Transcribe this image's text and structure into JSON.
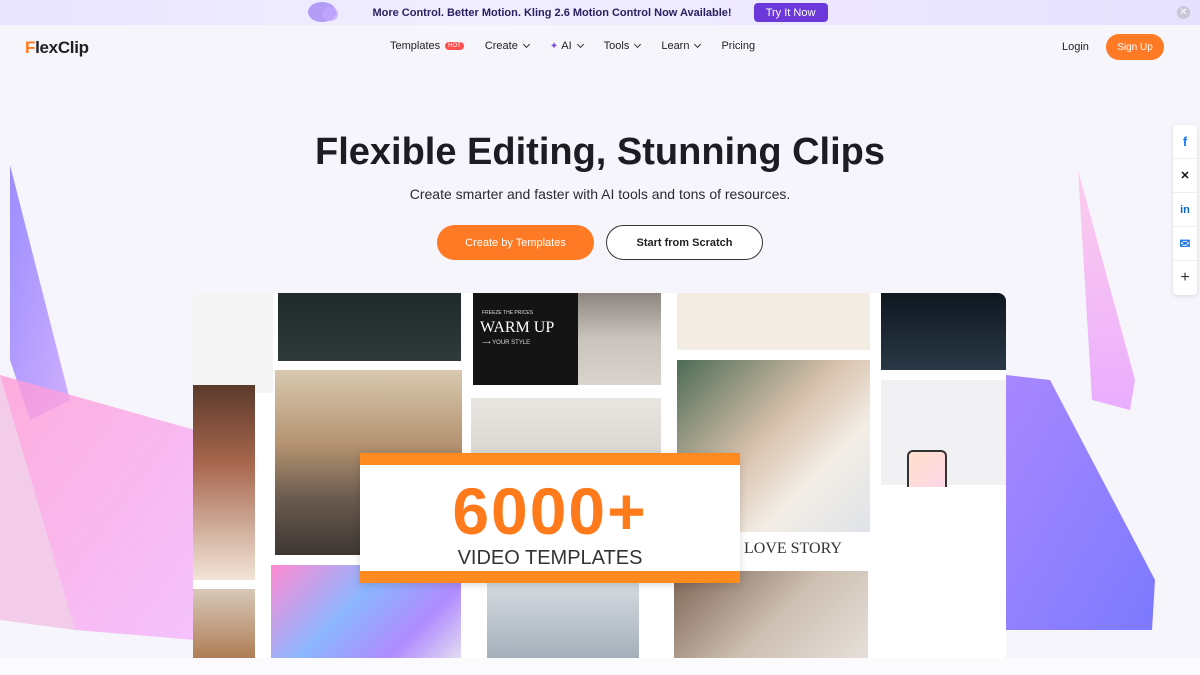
{
  "banner": {
    "text": "More Control. Better Motion. Kling 2.6 Motion Control Now Available!",
    "button": "Try It Now",
    "close": "✕"
  },
  "nav": {
    "logo": "FlexClip",
    "items": [
      {
        "label": "Templates",
        "badge": "HOT",
        "dropdown": false
      },
      {
        "label": "Create",
        "dropdown": true
      },
      {
        "label": "AI",
        "dropdown": true
      },
      {
        "label": "Tools",
        "dropdown": true
      },
      {
        "label": "Learn",
        "dropdown": true
      },
      {
        "label": "Pricing",
        "dropdown": false
      }
    ],
    "login": "Login",
    "signup": "Sign Up"
  },
  "hero": {
    "title": "Flexible Editing, Stunning Clips",
    "subtitle": "Create smarter and faster with AI tools and tons of resources.",
    "primary_button": "Create by Templates",
    "secondary_button": "Start from Scratch"
  },
  "share": [
    {
      "icon": "facebook-icon",
      "glyph": "f"
    },
    {
      "icon": "x-icon",
      "glyph": "✕"
    },
    {
      "icon": "linkedin-icon",
      "glyph": "in"
    },
    {
      "icon": "email-icon",
      "glyph": "✉"
    },
    {
      "icon": "plus-icon",
      "glyph": "+"
    }
  ],
  "collage": {
    "count": "6000+",
    "label": "VIDEO TEMPLATES",
    "love_story": "LOVE STORY",
    "warm_up": "WARM UP",
    "warm_small": "FREEZE THE PRICES",
    "warm_style": "⟶ YOUR STYLE"
  },
  "colors": {
    "accent": "#ff7a24",
    "banner_button": "#6c38d9"
  }
}
